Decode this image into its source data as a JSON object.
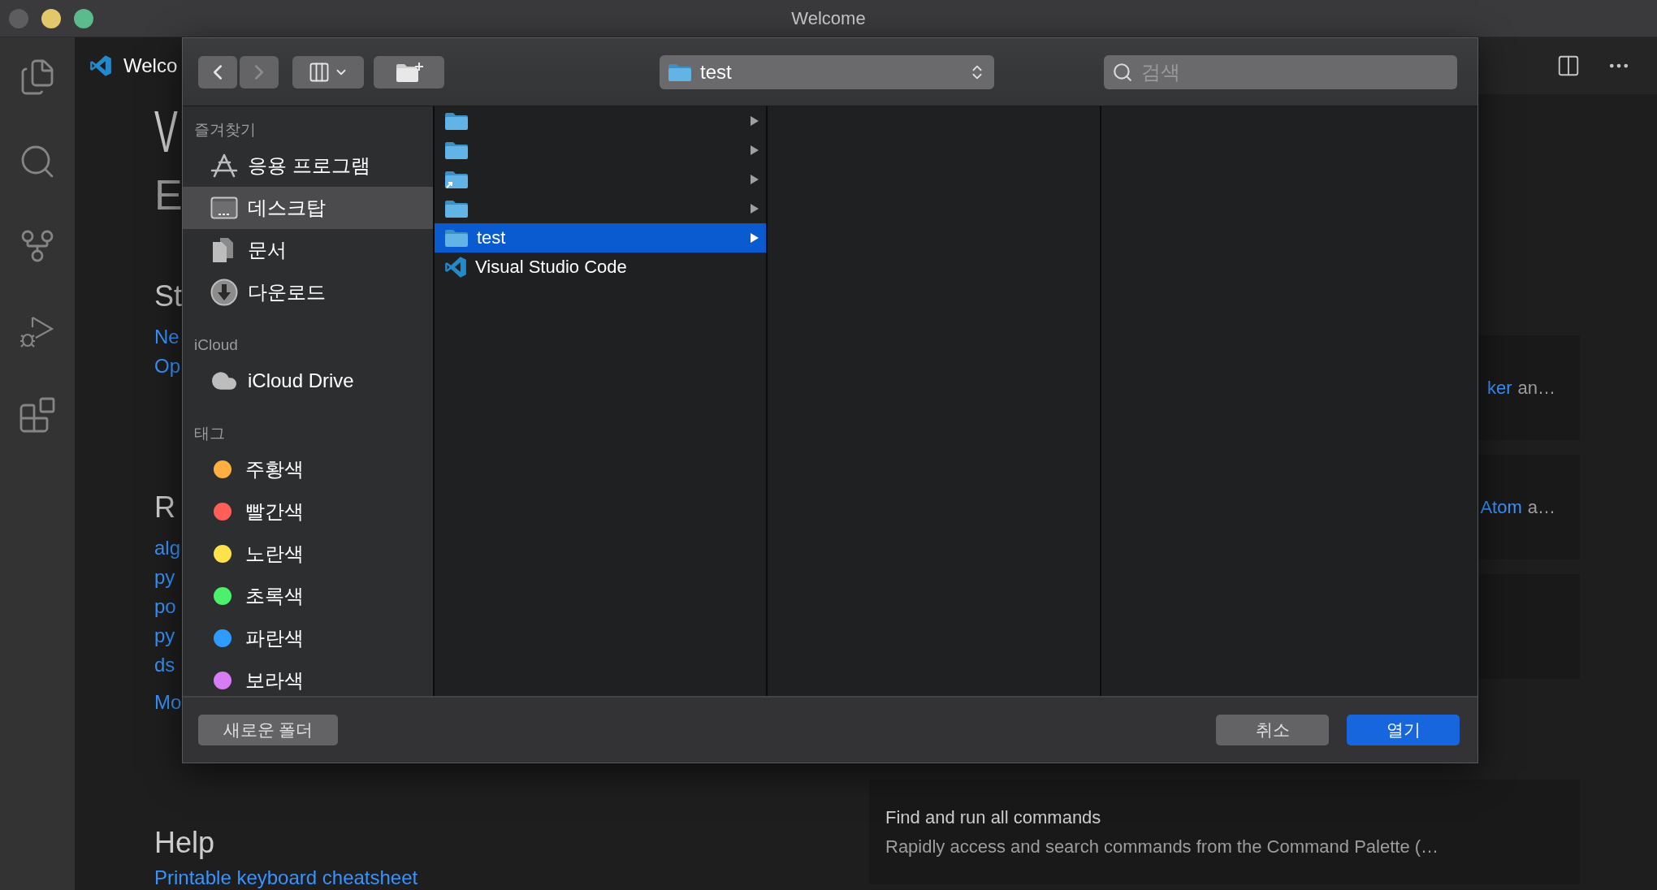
{
  "window": {
    "title": "Welcome"
  },
  "editor": {
    "tab": {
      "label": "Welco"
    },
    "welcome": {
      "title": "V",
      "subtitle": "E",
      "start": {
        "heading": "St",
        "links": [
          "Ne",
          "Op"
        ]
      },
      "recent": {
        "heading": "R",
        "links": [
          "alg",
          "py",
          "po",
          "py",
          "ds"
        ],
        "more": "Mo"
      },
      "help": {
        "heading": "Help",
        "links": [
          "Printable keyboard cheatsheet"
        ]
      },
      "cards": [
        {
          "kind": "link",
          "link": "ker",
          "text": "an…"
        },
        {
          "kind": "link",
          "link": "Atom",
          "text": "a…"
        },
        {
          "kind": "empty"
        },
        {
          "kind": "command",
          "title": "Find and run all commands",
          "text": "Rapidly access and search commands from the Command Palette (…"
        }
      ]
    }
  },
  "dialog": {
    "toolbar": {
      "path": "test",
      "search_placeholder": "검색"
    },
    "sidebar": {
      "sections": [
        {
          "kind": "places",
          "title": "즐겨찾기",
          "items": [
            {
              "label": "응용 프로그램",
              "selected": false
            },
            {
              "label": "데스크탑",
              "selected": true
            },
            {
              "label": "문서",
              "selected": false
            },
            {
              "label": "다운로드",
              "selected": false
            }
          ]
        },
        {
          "kind": "cloud",
          "title": "iCloud",
          "items": [
            {
              "label": "iCloud Drive",
              "selected": false
            }
          ]
        },
        {
          "kind": "tags",
          "title": "태그",
          "items": [
            {
              "label": "주황색",
              "color": "#ffae42",
              "selected": false
            },
            {
              "label": "빨간색",
              "color": "#ff5f57",
              "selected": false
            },
            {
              "label": "노란색",
              "color": "#ffe14c",
              "selected": false
            },
            {
              "label": "초록색",
              "color": "#4cf06a",
              "selected": false
            },
            {
              "label": "파란색",
              "color": "#2f9bff",
              "selected": false
            },
            {
              "label": "보라색",
              "color": "#d67cf4",
              "selected": false
            }
          ]
        }
      ]
    },
    "column": {
      "rows": [
        {
          "kind": "folder",
          "alias": false,
          "selected": false
        },
        {
          "kind": "folder",
          "alias": false,
          "selected": false
        },
        {
          "kind": "folder",
          "alias": true,
          "selected": false
        },
        {
          "kind": "folder",
          "alias": false,
          "selected": false
        },
        {
          "kind": "folder",
          "label": "test",
          "alias": false,
          "selected": true
        },
        {
          "kind": "app",
          "label": "Visual Studio Code",
          "selected": false
        }
      ]
    },
    "footer": {
      "new_folder": "새로운 폴더",
      "buttons": [
        {
          "label": "취소",
          "primary": false
        },
        {
          "label": "열기",
          "primary": true
        }
      ]
    }
  }
}
